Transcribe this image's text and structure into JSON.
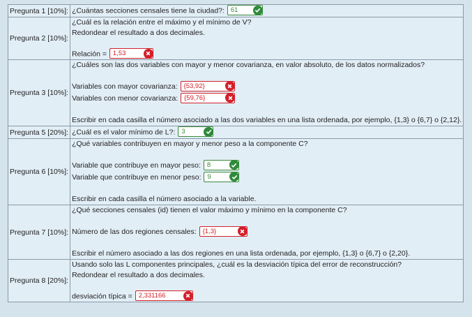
{
  "questions": [
    {
      "label": "Pregunta 1 [10%]:",
      "lines": {
        "text": "¿Cuántas secciones censales tiene la ciudad?:"
      },
      "answer": {
        "value": "61",
        "status": "correct"
      }
    },
    {
      "label": "Pregunta 2 [10%]:",
      "lines": [
        "¿Cuál es la relación entre el máximo y el mínimo de V?",
        "Redondear el resultado a dos decimales."
      ],
      "answer_label": "Relación =",
      "answer": {
        "value": "1,53",
        "status": "incorrect"
      }
    },
    {
      "label": "Pregunta 3 [10%]:",
      "lines": [
        "¿Cuáles son las dos variables con mayor y menor covarianza, en valor absoluto, de los datos normalizados?"
      ],
      "fields": [
        {
          "label": "Variables con mayor covarianza:",
          "value": "{53,92}",
          "status": "incorrect"
        },
        {
          "label": "Variables con menor covarianza:",
          "value": "{59,76}",
          "status": "incorrect"
        }
      ],
      "note": "Escribir en cada casilla el número asociado a las dos variables en una lista ordenada, por ejemplo, {1,3} o {6,7} o {2,12}."
    },
    {
      "label": "Pregunta 5 [20%]:",
      "lines": {
        "text": "¿Cuál es el valor mínimo de L?:"
      },
      "answer": {
        "value": "3",
        "status": "correct"
      }
    },
    {
      "label": "Pregunta 6 [10%]:",
      "lines": [
        "¿Qué variables contribuyen en mayor y menor peso a la componente C?"
      ],
      "fields": [
        {
          "label": "Variable que contribuye en mayor peso:",
          "value": "8",
          "status": "correct"
        },
        {
          "label": "Variable que contribuye en menor peso:",
          "value": "9",
          "status": "correct"
        }
      ],
      "note": "Escribir en cada casilla el número asociado a la variable."
    },
    {
      "label": "Pregunta 7 [10%]:",
      "lines": [
        "¿Qué secciones censales (id) tienen el valor máximo y mínimo en la componente C?"
      ],
      "fields": [
        {
          "label": "Número de las dos regiones censales:",
          "value": "{1,3}",
          "status": "incorrect"
        }
      ],
      "note": "Escribir el número asociado a las dos regiones en una lista ordenada, por ejemplo, {1,3} o {6,7} o {2,20}."
    },
    {
      "label": "Pregunta 8 [20%]:",
      "lines": [
        "Usando solo las L componentes principales, ¿cuál es la desviación típica del error de reconstrucción?",
        "Redondear el resultado a dos decimales."
      ],
      "answer_label": "desviación típica =",
      "answer": {
        "value": "2,331166",
        "status": "incorrect"
      }
    }
  ],
  "icons": {
    "correct": "check-circle-icon",
    "incorrect": "x-circle-icon"
  },
  "colors": {
    "correct": "#2f8a3a",
    "incorrect": "#d2202a",
    "cell_bg": "#e2eef6",
    "border": "#8a9aa6"
  }
}
